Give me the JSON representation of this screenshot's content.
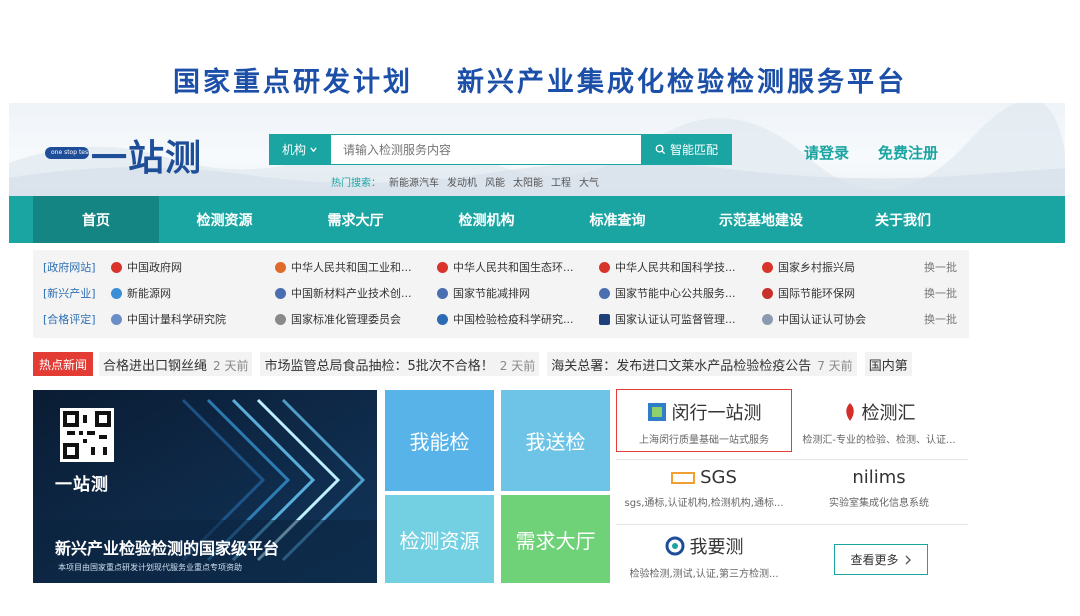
{
  "slogan": {
    "left": "国家重点研发计划",
    "right": "新兴产业集成化检验检测服务平台"
  },
  "logo": {
    "mark_text": "one stop test",
    "word": "一站测"
  },
  "search": {
    "category": "机构",
    "placeholder": "请输入检测服务内容",
    "button": "智能匹配"
  },
  "hot": {
    "label": "热门搜索：",
    "terms": [
      "新能源汽车",
      "发动机",
      "风能",
      "太阳能",
      "工程",
      "大气"
    ]
  },
  "account": {
    "login": "请登录",
    "register": "免费注册"
  },
  "nav": [
    "首页",
    "检测资源",
    "需求大厅",
    "检测机构",
    "标准查询",
    "示范基地建设",
    "关于我们"
  ],
  "link_rows": [
    {
      "category": "[政府网站]",
      "links": [
        "中国政府网",
        "中华人民共和国工业和...",
        "中华人民共和国生态环...",
        "中华人民共和国科学技...",
        "国家乡村振兴局"
      ],
      "more": "换一批"
    },
    {
      "category": "[新兴产业]",
      "links": [
        "新能源网",
        "中国新材料产业技术创...",
        "国家节能减排网",
        "国家节能中心公共服务...",
        "国际节能环保网"
      ],
      "more": "换一批"
    },
    {
      "category": "[合格评定]",
      "links": [
        "中国计量科学研究院",
        "国家标准化管理委员会",
        "中国检验检疫科学研究...",
        "国家认证认可监督管理...",
        "中国认证认可协会"
      ],
      "more": "换一批"
    }
  ],
  "news": {
    "tag": "热点新闻",
    "items": [
      {
        "title": "合格进出口钢丝绳",
        "time": "2 天前"
      },
      {
        "title": "市场监管总局食品抽检：5批次不合格！",
        "time": "2 天前"
      },
      {
        "title": "海关总署：发布进口文莱水产品检验检疫公告",
        "time": "7 天前"
      },
      {
        "title": "国内第",
        "time": ""
      }
    ]
  },
  "banner": {
    "brand": "一站测",
    "headline": "新兴产业检验检测的国家级平台",
    "sub": "本项目由国家重点研发计划现代服务业重点专项资助"
  },
  "tiles": [
    "我能检",
    "我送检",
    "检测资源",
    "需求大厅"
  ],
  "partners": [
    {
      "name": "闵行一站测",
      "desc": "上海闵行质量基础一站式服务"
    },
    {
      "name": "检测汇",
      "desc": "检测汇-专业的检验、检测、认证..."
    },
    {
      "name": "SGS",
      "desc": "sgs,通标,认证机构,检测机构,通标..."
    },
    {
      "name": "nilims",
      "desc": "实验室集成化信息系统"
    },
    {
      "name": "我要测",
      "desc": "检验检测,测试,认证,第三方检测..."
    }
  ],
  "more_button": "查看更多",
  "colors": {
    "teal": "#1aa5a2",
    "slogan_blue": "#1c4fa8",
    "news_red": "#e33c35",
    "tile_blue": "#57b3e8",
    "tile_cyan": "#6dc4e6",
    "tile_light": "#72d0e2",
    "tile_green": "#6fd278"
  }
}
